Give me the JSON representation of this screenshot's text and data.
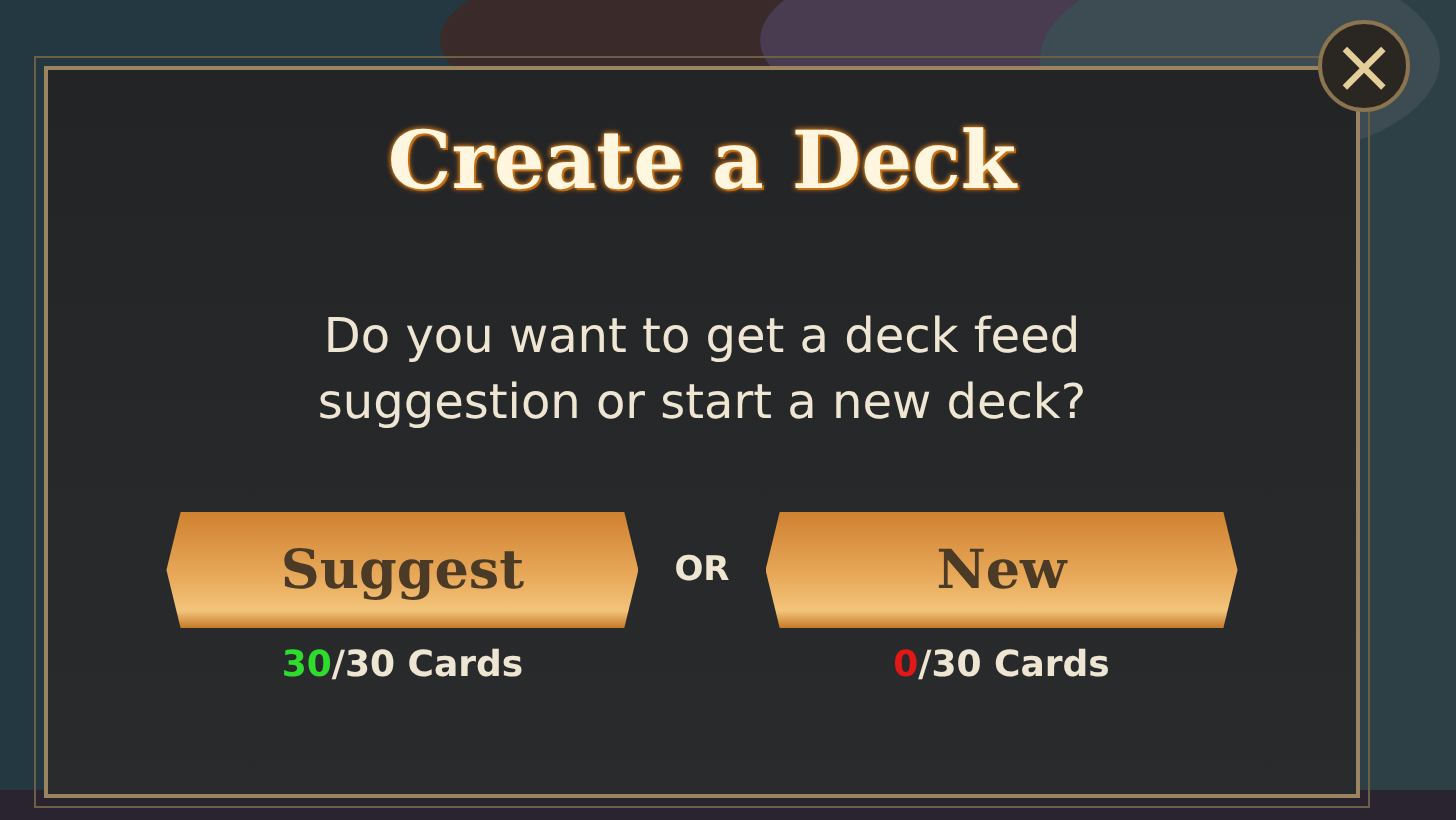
{
  "dialog": {
    "title": "Create a Deck",
    "message": "Do you want to get a deck feed suggestion or start a new deck?",
    "separator": "OR",
    "options": [
      {
        "label": "Suggest",
        "count": "30",
        "rest": "/30 Cards",
        "color": "#2edc2e"
      },
      {
        "label": "New",
        "count": "0",
        "rest": "/30 Cards",
        "color": "#e01818"
      }
    ],
    "close": "×"
  }
}
